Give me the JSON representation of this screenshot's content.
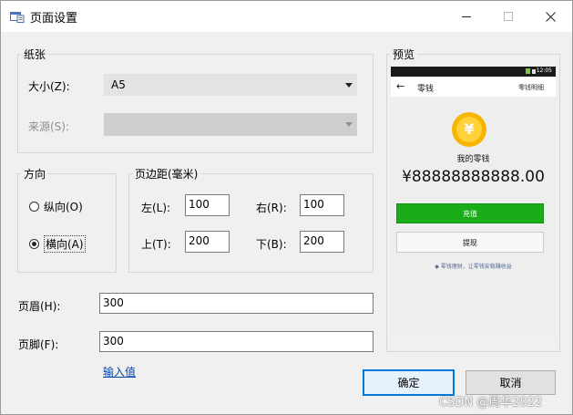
{
  "window": {
    "title": "页面设置",
    "controls": {
      "minimize": "—",
      "maximize": "☐",
      "close": "✕"
    }
  },
  "paper": {
    "legend": "纸张",
    "size_label": "大小(Z):",
    "size_value": "A5",
    "source_label": "来源(S):",
    "source_value": ""
  },
  "orientation": {
    "legend": "方向",
    "portrait": "纵向(O)",
    "landscape": "横向(A)",
    "selected": "landscape"
  },
  "margins": {
    "legend": "页边距(毫米)",
    "left_label": "左(L):",
    "left_value": "100",
    "right_label": "右(R):",
    "right_value": "100",
    "top_label": "上(T):",
    "top_value": "200",
    "bottom_label": "下(B):",
    "bottom_value": "200"
  },
  "header": {
    "label": "页眉(H):",
    "value": "300"
  },
  "footer": {
    "label": "页脚(F):",
    "value": "300"
  },
  "input_link": "输入值",
  "preview": {
    "legend": "预览",
    "status_time": "12:05",
    "page_title": "零钱",
    "detail_link": "零钱明细",
    "back_icon": "arrow-left-icon",
    "coin_symbol": "¥",
    "my_change": "我的零钱",
    "amount": "¥88888888888.00",
    "topup_button": "充值",
    "withdraw_button": "提现",
    "tip": "零钱理财，让零钱安稳赚收益"
  },
  "buttons": {
    "ok": "确定",
    "cancel": "取消"
  },
  "watermark": "CSDN @周华2022",
  "colors": {
    "accent": "#0078d7",
    "wechat_green": "#1aad19",
    "link": "#0645ad"
  }
}
